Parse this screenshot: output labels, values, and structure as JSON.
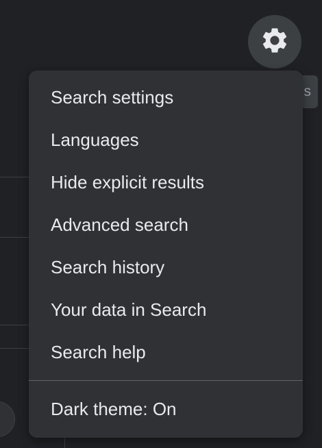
{
  "menu": {
    "items": [
      {
        "label": "Search settings"
      },
      {
        "label": "Languages"
      },
      {
        "label": "Hide explicit results"
      },
      {
        "label": "Advanced search"
      },
      {
        "label": "Search history"
      },
      {
        "label": "Your data in Search"
      },
      {
        "label": "Search help"
      }
    ],
    "theme_toggle": "Dark theme: On"
  },
  "background": {
    "chip_text": "s"
  },
  "icons": {
    "settings": "gear-icon"
  },
  "colors": {
    "page_background": "#202124",
    "menu_background": "#303134",
    "button_background": "#3c4043",
    "text": "#e8eaed"
  }
}
